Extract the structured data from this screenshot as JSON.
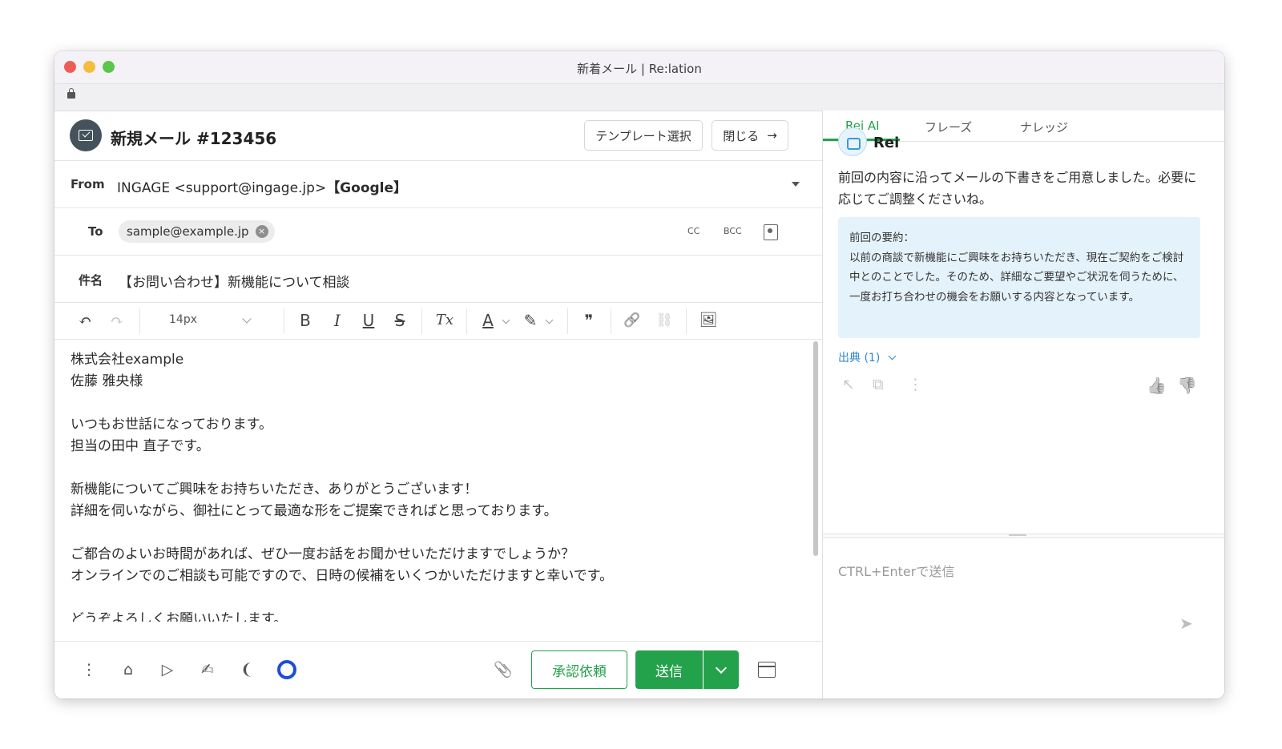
{
  "window": {
    "title": "新着メール | Re:lation"
  },
  "header": {
    "title": "新規メール #123456",
    "template_button": "テンプレート選択",
    "close_button": "閉じる",
    "close_arrow": "→"
  },
  "from": {
    "label": "From",
    "value": "INGAGE <support@ingage.jp>",
    "account": "【Google】"
  },
  "to": {
    "label": "To",
    "recipient": "sample@example.jp",
    "remove": "×",
    "cc": "CC",
    "bcc": "BCC"
  },
  "subject": {
    "label": "件名",
    "value": "【お問い合わせ】新機能について相談"
  },
  "toolbar": {
    "undo": "↶",
    "redo": "↷",
    "font_size": "14px",
    "bold": "B",
    "italic": "I",
    "underline": "U",
    "strike": "S",
    "clear": "Tx",
    "font_color": "A",
    "highlight": "✎",
    "quote": "❞",
    "link": "🔗",
    "unlink": "⛓",
    "image": "🖼"
  },
  "body": {
    "text": "株式会社example\n佐藤 雅央様\n\nいつもお世話になっております。\n担当の田中 直子です。\n\n新機能についてご興味をお持ちいただき、ありがとうございます！\n詳細を伺いながら、御社にとって最適な形をご提案できればと思っております。\n\nご都合のよいお時間があれば、ぜひ一度お話をお聞かせいただけますでしょうか？\nオンラインでのご相談も可能ですので、日時の候補をいくつかいただけますと幸いです。\n\nどうぞよろしくお願いいたします。"
  },
  "footer": {
    "more": "⋮",
    "tag": "⌂",
    "label": "▷",
    "sign": "✍",
    "listen": "❨",
    "attach": "📎",
    "approve_button": "承認依頼",
    "send_button": "送信"
  },
  "panel": {
    "tabs": [
      "Rei AI",
      "フレーズ",
      "ナレッジ"
    ],
    "assistant_name": "Rei",
    "message": "前回の内容に沿ってメールの下書きをご用意しました。必要に応じてご調整くださいね。",
    "summary_title": "前回の要約：",
    "summary_body": "以前の商談で新機能にご興味をお持ちいただき、現在ご契約をご検討中とのことでした。そのため、詳細なご要望やご状況を伺うために、一度お打ち合わせの機会をお願いする内容となっています。",
    "source": "出典 (1)",
    "insert": "↖",
    "copy": "⧉",
    "more": "⋮",
    "thumb_up": "👍",
    "thumb_down": "👎",
    "input_placeholder": "CTRL+Enterで送信",
    "send": "➤"
  },
  "colors": {
    "accent": "#24a14b",
    "summary_bg": "#e4f2fb",
    "link": "#2f86c9",
    "ring": "#1d4ed8"
  }
}
